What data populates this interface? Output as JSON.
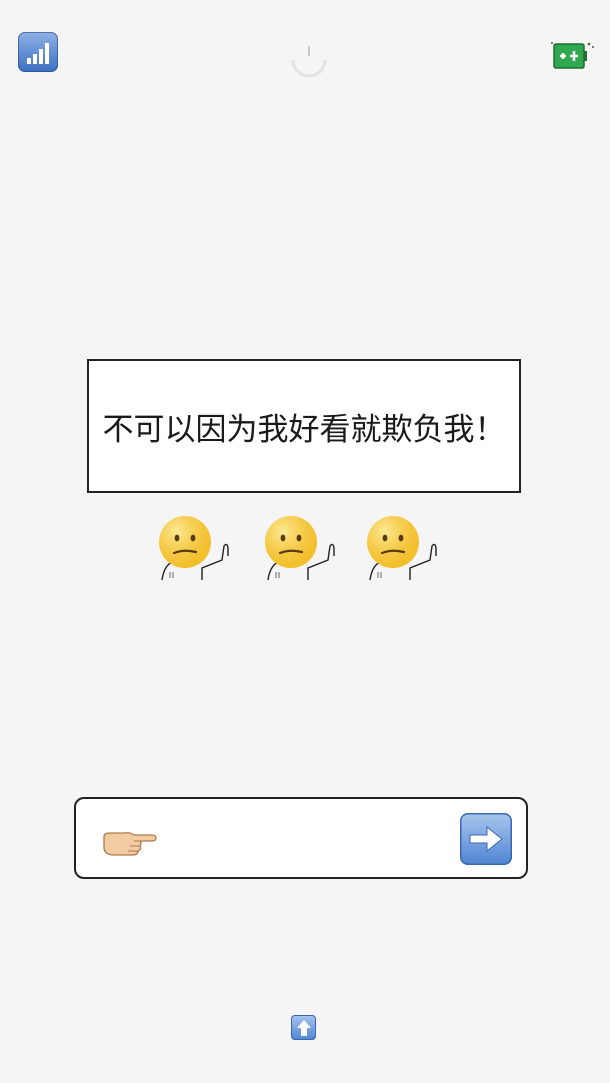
{
  "icons": {
    "signal": "signal-bars-icon",
    "loader": "loading-spinner-icon",
    "battery": "battery-charging-icon",
    "figure": "confused-face-stick-figure-icon",
    "pointer": "pointing-hand-icon",
    "send": "right-arrow-icon",
    "scroll_up": "up-arrow-icon"
  },
  "message": {
    "text": "不可以因为我好看就欺负我！"
  },
  "figures": [
    {
      "id": "figure-1"
    },
    {
      "id": "figure-2"
    },
    {
      "id": "figure-3"
    }
  ],
  "input_bar": {
    "value": "",
    "placeholder": ""
  },
  "colors": {
    "background": "#f5f5f5",
    "button_blue": "#4f84d3",
    "face_yellow": "#f7c62f",
    "battery_green": "#2fa84f"
  }
}
